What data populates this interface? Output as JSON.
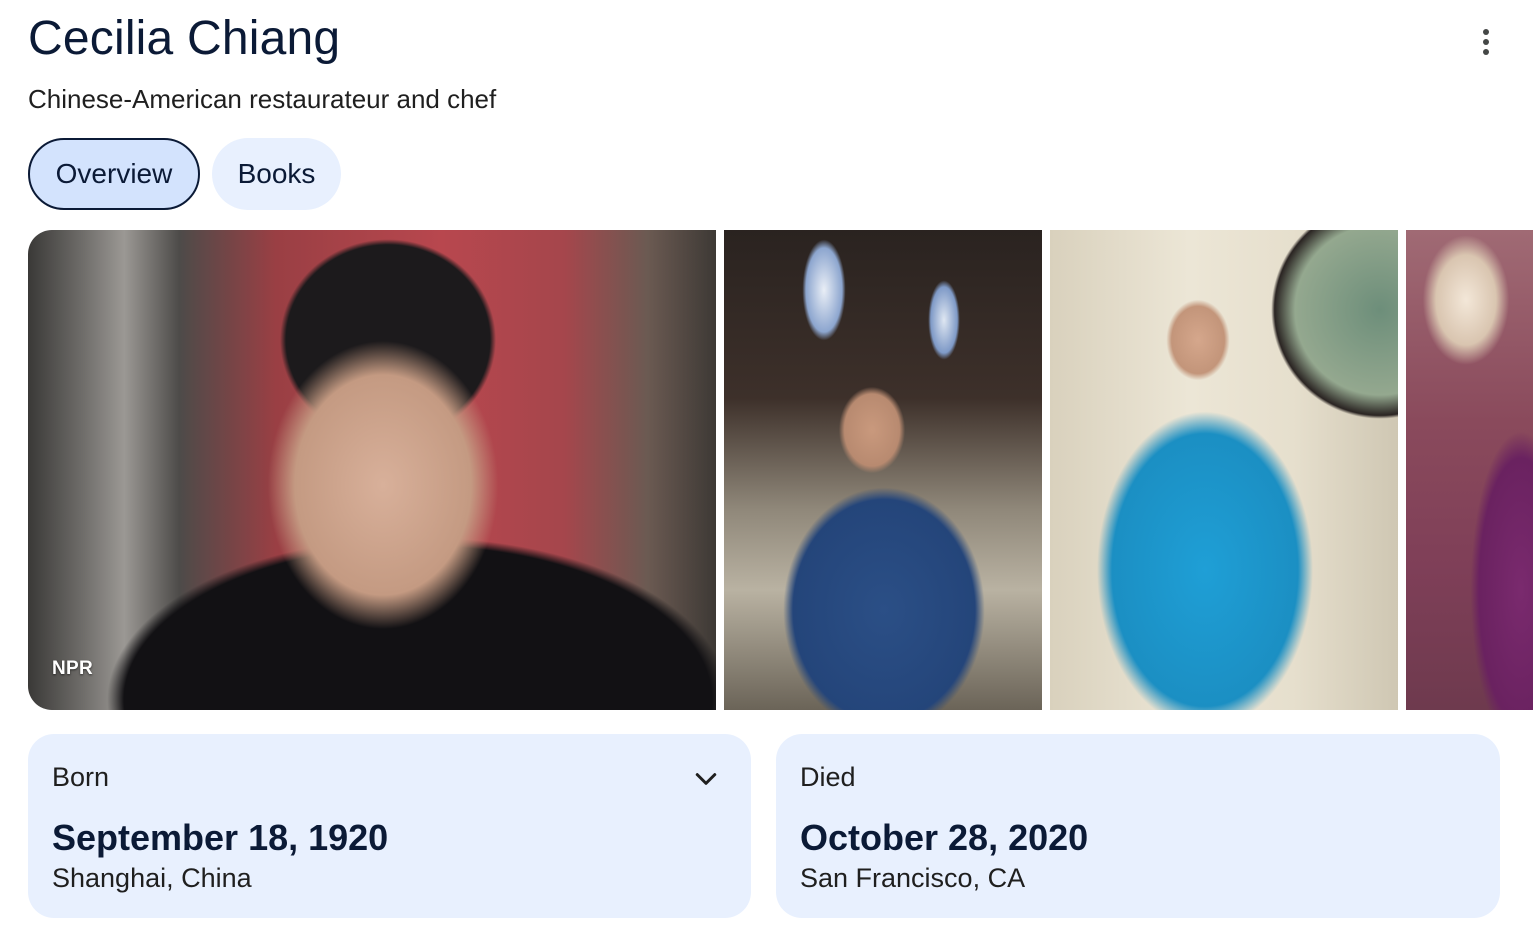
{
  "header": {
    "title": "Cecilia Chiang",
    "subtitle": "Chinese-American restaurateur and chef",
    "more_icon": "more-vert-icon"
  },
  "tabs": [
    {
      "label": "Overview",
      "selected": true
    },
    {
      "label": "Books",
      "selected": false
    }
  ],
  "images": [
    {
      "credit": "NPR"
    },
    {
      "credit": ""
    },
    {
      "credit": ""
    },
    {
      "credit": ""
    }
  ],
  "facts": {
    "born": {
      "label": "Born",
      "date": "September 18, 1920",
      "place": "Shanghai, China",
      "expand_icon": "chevron-down-icon"
    },
    "died": {
      "label": "Died",
      "date": "October 28, 2020",
      "place": "San Francisco, CA"
    }
  },
  "colors": {
    "tab_selected_bg": "#d3e3fd",
    "tab_bg": "#e8f0fe",
    "card_bg": "#e8f0fe",
    "title_text": "#0b1a36"
  }
}
